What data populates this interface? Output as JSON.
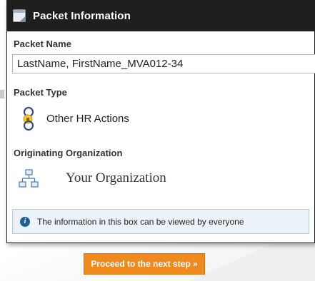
{
  "header": {
    "title": "Packet Information",
    "icon": "document-icon"
  },
  "packet_name": {
    "label": "Packet Name",
    "value": "LastName, FirstName_MVA012-34"
  },
  "packet_type": {
    "label": "Packet Type",
    "value": "Other HR Actions",
    "icon": "hr-actions-icon"
  },
  "originating_org": {
    "label": "Originating Organization",
    "value": "Your Organization",
    "icon": "org-chart-icon"
  },
  "info": {
    "text": "The information in this box can be viewed by everyone",
    "icon": "info-icon"
  },
  "actions": {
    "proceed_label": "Proceed to the next step »"
  },
  "colors": {
    "header_bg": "#1f1f1f",
    "button_bg": "#f08a1e",
    "info_bg": "#ecf3f8",
    "info_icon": "#1e5f96"
  }
}
